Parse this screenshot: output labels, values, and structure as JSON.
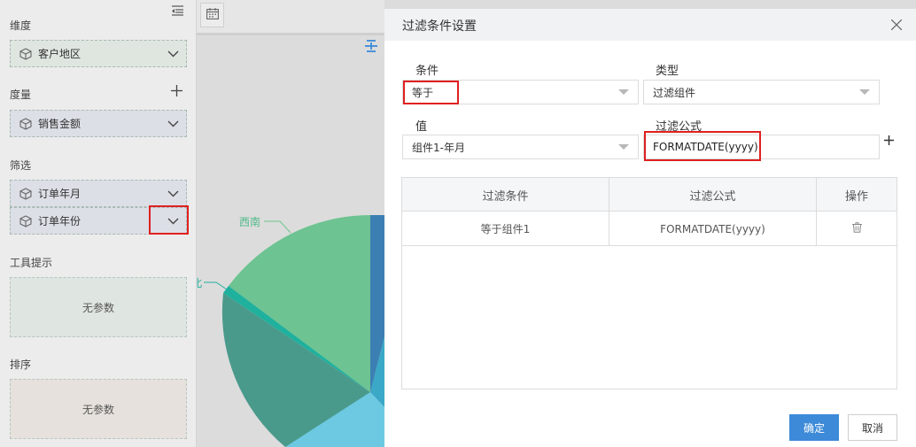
{
  "left_panel": {
    "dimension_title": "维度",
    "dimension_field": "客户地区",
    "measure_title": "度量",
    "measure_field": "销售金额",
    "filter_title": "筛选",
    "filter_field_1": "订单年月",
    "filter_field_2": "订单年份",
    "tooltip_title": "工具提示",
    "tooltip_placeholder": "无参数",
    "sort_title": "排序",
    "sort_placeholder": "无参数"
  },
  "chart": {
    "label_southwest": "西南",
    "label_partial": "北",
    "colors": [
      "#6dc391",
      "#4a9a8c",
      "#1fb19d",
      "#3b7fb3",
      "#6dc9e1",
      "#3ba8c8"
    ]
  },
  "dialog": {
    "title": "过滤条件设置",
    "condition_label": "条件",
    "condition_value": "等于",
    "type_label": "类型",
    "type_value": "过滤组件",
    "value_label": "值",
    "value_value": "组件1-年月",
    "formula_label": "过滤公式",
    "formula_value": "FORMATDATE(yyyy)",
    "table": {
      "headers": [
        "过滤条件",
        "过滤公式",
        "操作"
      ],
      "rows": [
        {
          "condition": "等于组件1",
          "formula": "FORMATDATE(yyyy)"
        }
      ]
    },
    "ok_label": "确定",
    "cancel_label": "取消"
  }
}
